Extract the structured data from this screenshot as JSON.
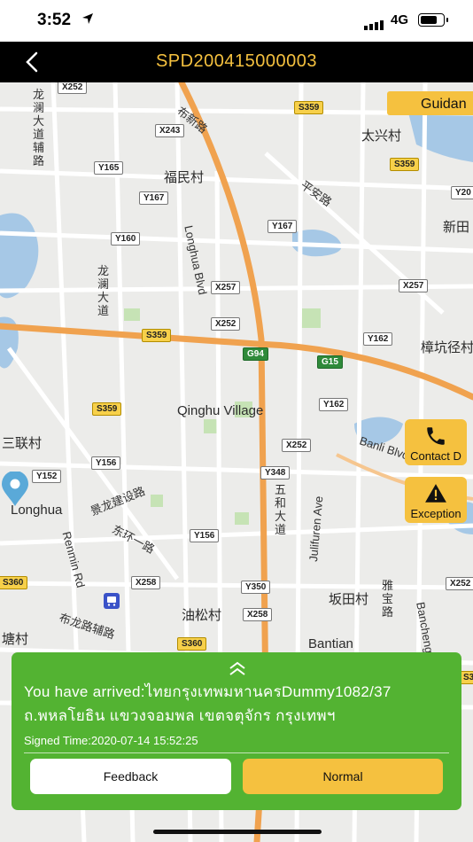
{
  "status_bar": {
    "time": "3:52",
    "network": "4G"
  },
  "nav": {
    "title": "SPD200415000003"
  },
  "map": {
    "guidance_label": "Guidan",
    "labels": [
      {
        "text": "龙澜大道辅路",
        "cls": "lbl",
        "vertical": true
      },
      {
        "text": "布新路",
        "cls": "lbl"
      },
      {
        "text": "太兴村",
        "cls": "lbl big"
      },
      {
        "text": "福民村",
        "cls": "lbl big"
      },
      {
        "text": "平安路",
        "cls": "lbl"
      },
      {
        "text": "Longhua Blvd",
        "cls": "lbl"
      },
      {
        "text": "新田",
        "cls": "lbl big"
      },
      {
        "text": "龙澜大道",
        "cls": "lbl",
        "vertical": true
      },
      {
        "text": "樟坑径村",
        "cls": "lbl big"
      },
      {
        "text": "Qinghu Village",
        "cls": "lbl big"
      },
      {
        "text": "三联村",
        "cls": "lbl big"
      },
      {
        "text": "Banli Blvd",
        "cls": "lbl"
      },
      {
        "text": "Longhua",
        "cls": "lbl big"
      },
      {
        "text": "景龙建设路",
        "cls": "lbl"
      },
      {
        "text": "五和大道",
        "cls": "lbl",
        "vertical": true
      },
      {
        "text": "Julifuren Ave",
        "cls": "lbl"
      },
      {
        "text": "Renmin Rd",
        "cls": "lbl"
      },
      {
        "text": "东环一路",
        "cls": "lbl"
      },
      {
        "text": "坂田村",
        "cls": "lbl big"
      },
      {
        "text": "油松村",
        "cls": "lbl big"
      },
      {
        "text": "布龙路辅路",
        "cls": "lbl"
      },
      {
        "text": "塘村",
        "cls": "lbl big"
      },
      {
        "text": "Bantian",
        "cls": "lbl big"
      },
      {
        "text": "雅宝路",
        "cls": "lbl"
      },
      {
        "text": "Bancheng E Rd",
        "cls": "lbl"
      }
    ],
    "road_tags": [
      "X252",
      "S359",
      "X243",
      "Y165",
      "S359",
      "Y167",
      "Y20",
      "Y167",
      "Y160",
      "X257",
      "X257",
      "X252",
      "S359",
      "G94",
      "G15",
      "Y162",
      "Y162",
      "S359",
      "X252",
      "Y348",
      "Y152",
      "Y156",
      "Y156",
      "S360",
      "X258",
      "Y350",
      "X252",
      "X258",
      "S360",
      "S360"
    ]
  },
  "side_buttons": {
    "contact": "Contact D",
    "exception": "Exception"
  },
  "panel": {
    "arrived_text": "You have arrived:ไทยกรุงเทพมหานครDummy1082/37 ถ.พหลโยธิน แขวงจอมพล เขตจตุจักร กรุงเทพฯ",
    "signed_time": "Signed Time:2020-07-14 15:52:25",
    "feedback_label": "Feedback",
    "normal_label": "Normal"
  },
  "colors": {
    "accent": "#f5c13f",
    "panel": "#53b332",
    "nav": "#000000",
    "map_bg": "#ececea",
    "road_major": "#f0a24f"
  }
}
